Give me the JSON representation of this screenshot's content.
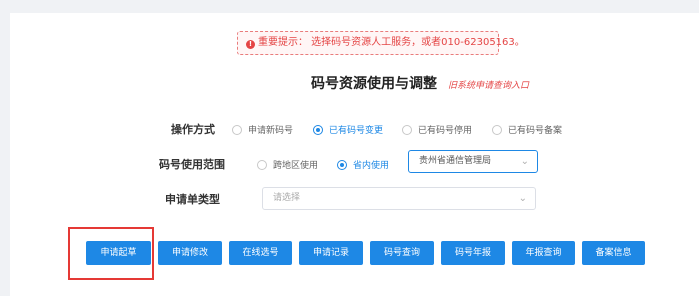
{
  "notice": {
    "icon": "alert-circle-icon",
    "text": "重要提示： 选择码号资源人工服务，或者010-62305163。"
  },
  "page_title": "码号资源使用与调整",
  "old_system_link": "旧系统申请查询入口",
  "operation": {
    "label": "操作方式",
    "options": [
      "申请新码号",
      "已有码号变更",
      "已有码号停用",
      "已有码号备案"
    ],
    "selected": "已有码号变更"
  },
  "scope": {
    "label": "码号使用范围",
    "options": [
      "跨地区使用",
      "省内使用"
    ],
    "selected": "省内使用",
    "select_value": "贵州省通信管理局"
  },
  "apply_type": {
    "label": "申请单类型",
    "placeholder": "请选择"
  },
  "buttons": [
    "申请起草",
    "申请修改",
    "在线选号",
    "申请记录",
    "码号查询",
    "码号年报",
    "年报查询",
    "备案信息"
  ],
  "colors": {
    "primary": "#1e88e5",
    "alert": "#e44545",
    "highlight_box": "#e53935"
  }
}
